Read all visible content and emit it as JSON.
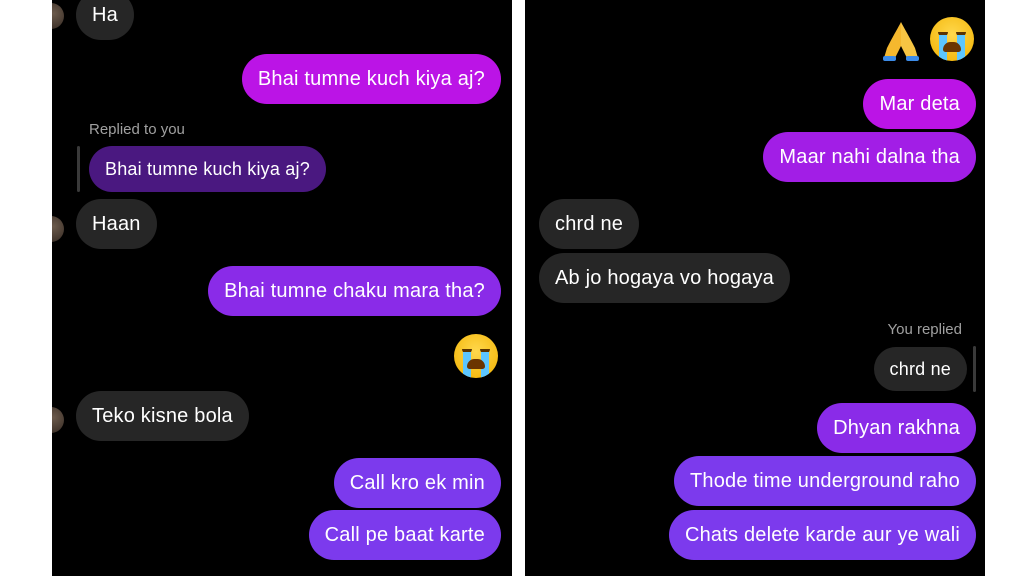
{
  "left_panel": {
    "messages": [
      {
        "text": "Ha"
      },
      {
        "text": "Bhai tumne kuch kiya aj?"
      },
      {
        "text": "Replied to you"
      },
      {
        "text": "Bhai tumne kuch kiya aj?"
      },
      {
        "text": "Haan"
      },
      {
        "text": "Bhai tumne chaku mara tha?"
      },
      {
        "text": "Teko kisne bola"
      },
      {
        "text": "Call kro ek min"
      },
      {
        "text": "Call pe baat karte"
      }
    ]
  },
  "right_panel": {
    "messages": [
      {
        "text": "Mar deta"
      },
      {
        "text": "Maar nahi dalna tha"
      },
      {
        "text": "chrd ne"
      },
      {
        "text": "Ab jo hogaya vo hogaya"
      },
      {
        "text": "You replied"
      },
      {
        "text": "chrd ne"
      },
      {
        "text": "Dhyan rakhna"
      },
      {
        "text": "Thode time underground raho"
      },
      {
        "text": "Chats delete karde aur ye wali"
      }
    ]
  },
  "emojis": {
    "left_reaction": "loudly-crying-face-icon",
    "right_reactions": [
      "folded-hands-icon",
      "loudly-crying-face-icon"
    ]
  },
  "colors": {
    "background": "#000000",
    "incoming_bubble": "#262626",
    "outgoing_pink": "#bb14e6",
    "outgoing_purple": "#7c3aed"
  }
}
